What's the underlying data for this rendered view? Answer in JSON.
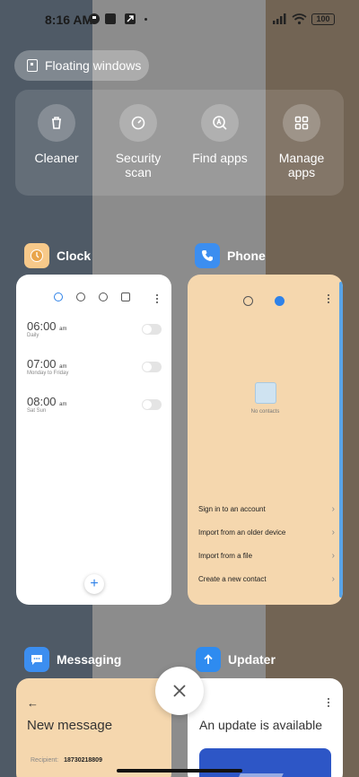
{
  "status_bar": {
    "time": "8:16 AM",
    "battery": "100"
  },
  "floating_windows": {
    "label": "Floating windows"
  },
  "quick_tools": [
    {
      "label": "Cleaner",
      "icon": "trash-icon"
    },
    {
      "label": "Security scan",
      "icon": "shield-scan-icon"
    },
    {
      "label": "Find apps",
      "icon": "find-apps-icon"
    },
    {
      "label": "Manage apps",
      "icon": "grid-icon"
    }
  ],
  "apps": {
    "clock": {
      "name": "Clock",
      "icon_color": "#f7c98a",
      "alarms": [
        {
          "time": "06:00",
          "suffix": "am",
          "repeat": "Daily"
        },
        {
          "time": "07:00",
          "suffix": "am",
          "repeat": "Monday to Friday"
        },
        {
          "time": "08:00",
          "suffix": "am",
          "repeat": "Sat Sun"
        }
      ],
      "add": "+"
    },
    "phone": {
      "name": "Phone",
      "icon_color": "#3c8ef0",
      "empty": "No contacts",
      "actions": [
        "Sign in to an account",
        "Import from an older device",
        "Import from a file",
        "Create a new contact"
      ]
    },
    "messaging": {
      "name": "Messaging",
      "icon_color": "#3c8ef0",
      "back": "←",
      "title": "New message",
      "recipient_label": "Recipient:",
      "recipient_value": "18730218809"
    },
    "updater": {
      "name": "Updater",
      "icon_color": "#2e8bf0",
      "title": "An update is available"
    }
  },
  "colors": {
    "accent": "#2f82e8",
    "card_peach": "#f5d7ae"
  }
}
